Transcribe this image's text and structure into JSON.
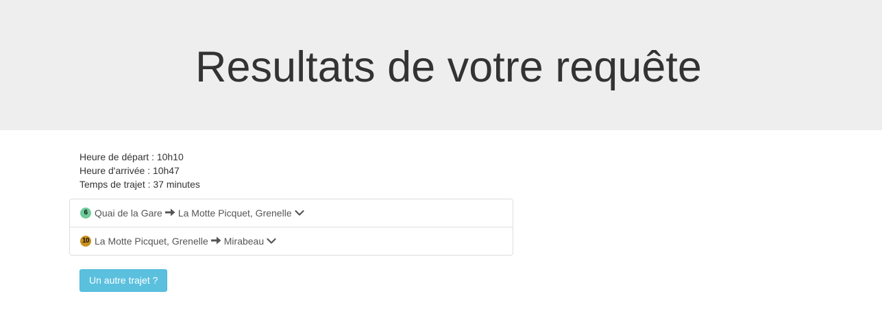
{
  "header": {
    "title": "Resultats de votre requête"
  },
  "summary": {
    "departure": "Heure de départ : 10h10",
    "arrival": "Heure d'arrivée : 10h47",
    "duration": "Temps de trajet : 37 minutes"
  },
  "legs": [
    {
      "line": "6",
      "line_color": "#6ecb9a",
      "from": "Quai de la Gare",
      "to": "La Motte Picquet, Grenelle",
      "arrow_icon": "arrow-right-icon",
      "toggle_icon": "chevron-down-icon"
    },
    {
      "line": "10",
      "line_color": "#c9911f",
      "from": "La Motte Picquet, Grenelle",
      "to": "Mirabeau",
      "arrow_icon": "arrow-right-icon",
      "toggle_icon": "chevron-down-icon"
    }
  ],
  "actions": {
    "another_trip_label": "Un autre trajet ?"
  },
  "colors": {
    "header_bg": "#eeeeee",
    "button_bg": "#5bc0de",
    "button_border": "#46b8da"
  }
}
